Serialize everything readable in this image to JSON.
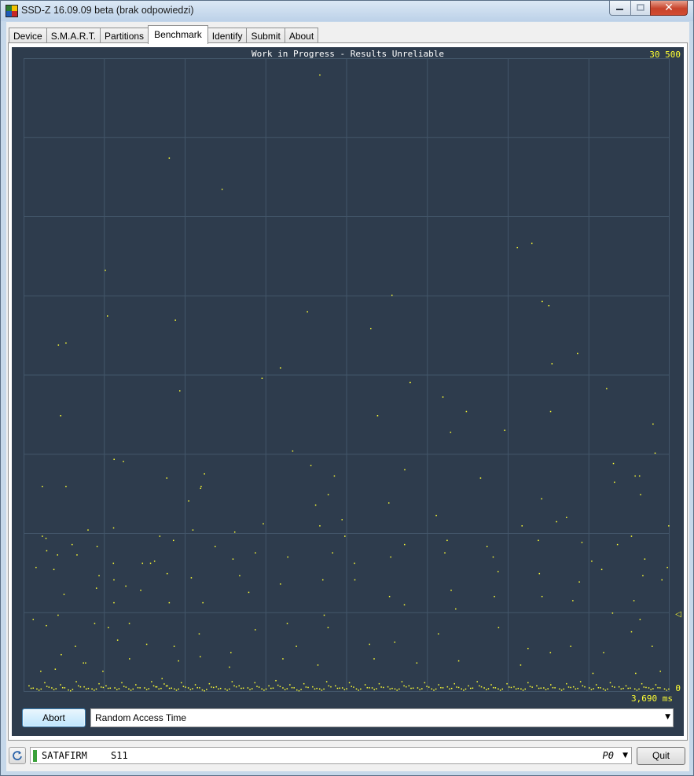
{
  "window": {
    "title": "SSD-Z 16.09.09 beta (brak odpowiedzi)",
    "close_glyph": "✕",
    "minimize_glyph": "—",
    "maximize_glyph": "□"
  },
  "tabs": [
    {
      "label": "Device",
      "active": false
    },
    {
      "label": "S.M.A.R.T.",
      "active": false
    },
    {
      "label": "Partitions",
      "active": false
    },
    {
      "label": "Benchmark",
      "active": true
    },
    {
      "label": "Identify",
      "active": false
    },
    {
      "label": "Submit",
      "active": false
    },
    {
      "label": "About",
      "active": false
    }
  ],
  "benchmark": {
    "status_title": "Work in Progress - Results Unreliable",
    "y_max_label": "30 500",
    "y_min_label": "0",
    "x_max_label": "3,690 ms",
    "marker_glyph": "◁",
    "abort_label": "Abort",
    "mode_select_value": "Random Access Time",
    "point_color": "#ffff33",
    "background_color": "#2e3c4d",
    "grid_color": "#43566a"
  },
  "status_bar": {
    "drive_model": "SATAFIRM",
    "drive_firmware": "S11",
    "port_value": "P0",
    "quit_label": "Quit"
  },
  "chart_data": {
    "type": "scatter",
    "title": "Work in Progress - Results Unreliable",
    "xlabel": "",
    "ylabel": "",
    "ylim": [
      0,
      30500
    ],
    "xlim": [
      0,
      3690
    ],
    "grid": true,
    "y_tick_labels": [
      "0",
      "30 500"
    ],
    "x_tick_labels": [
      "3,690 ms"
    ],
    "series": [
      {
        "points": [
          [
            1691,
            29700
          ],
          [
            831,
            25700
          ],
          [
            1133,
            24200
          ],
          [
            2819,
            21400
          ],
          [
            2902,
            21600
          ],
          [
            2103,
            19100
          ],
          [
            466,
            20300
          ],
          [
            1620,
            18300
          ],
          [
            2961,
            18800
          ],
          [
            2999,
            18600
          ],
          [
            478,
            18100
          ],
          [
            866,
            17900
          ],
          [
            1982,
            17500
          ],
          [
            3163,
            16300
          ],
          [
            198,
            16700
          ],
          [
            241,
            16800
          ],
          [
            3017,
            15800
          ],
          [
            2207,
            14900
          ],
          [
            1361,
            15100
          ],
          [
            211,
            13300
          ],
          [
            1466,
            15600
          ],
          [
            2528,
            13500
          ],
          [
            2394,
            14200
          ],
          [
            2438,
            12500
          ],
          [
            3009,
            13500
          ],
          [
            891,
            14500
          ],
          [
            2747,
            12600
          ],
          [
            3329,
            14600
          ],
          [
            3594,
            12900
          ],
          [
            3517,
            10400
          ],
          [
            516,
            11200
          ],
          [
            1536,
            11600
          ],
          [
            2021,
            13300
          ],
          [
            3606,
            11500
          ],
          [
            3368,
            11000
          ],
          [
            3374,
            10100
          ],
          [
            1032,
            10500
          ],
          [
            569,
            11100
          ],
          [
            1013,
            9900
          ],
          [
            1774,
            10400
          ],
          [
            1640,
            10900
          ],
          [
            1739,
            9500
          ],
          [
            2176,
            10700
          ],
          [
            2609,
            10300
          ],
          [
            2958,
            9300
          ],
          [
            3492,
            10400
          ],
          [
            3523,
            9500
          ],
          [
            106,
            9900
          ],
          [
            241,
            9900
          ],
          [
            1010,
            9800
          ],
          [
            942,
            9200
          ],
          [
            817,
            10300
          ],
          [
            1667,
            9000
          ],
          [
            1818,
            8300
          ],
          [
            2085,
            9100
          ],
          [
            2356,
            8500
          ],
          [
            2846,
            8000
          ],
          [
            3043,
            8200
          ],
          [
            3100,
            8400
          ],
          [
            3684,
            8000
          ],
          [
            106,
            7500
          ],
          [
            367,
            7800
          ],
          [
            513,
            7900
          ],
          [
            777,
            7500
          ],
          [
            966,
            7800
          ],
          [
            1205,
            7700
          ],
          [
            1368,
            8100
          ],
          [
            1691,
            8000
          ],
          [
            1834,
            7500
          ],
          [
            2175,
            7100
          ],
          [
            2418,
            7300
          ],
          [
            2646,
            7000
          ],
          [
            2939,
            7300
          ],
          [
            3188,
            7200
          ],
          [
            3471,
            7500
          ],
          [
            127,
            7400
          ],
          [
            131,
            6800
          ],
          [
            193,
            6600
          ],
          [
            276,
            7100
          ],
          [
            304,
            6600
          ],
          [
            419,
            7000
          ],
          [
            512,
            6200
          ],
          [
            678,
            6200
          ],
          [
            747,
            6300
          ],
          [
            855,
            7300
          ],
          [
            1093,
            7000
          ],
          [
            1195,
            6400
          ],
          [
            1323,
            6700
          ],
          [
            1508,
            6500
          ],
          [
            1764,
            6700
          ],
          [
            1889,
            6200
          ],
          [
            2096,
            6500
          ],
          [
            2405,
            6700
          ],
          [
            2681,
            6500
          ],
          [
            3244,
            6300
          ],
          [
            3391,
            7100
          ],
          [
            3547,
            6400
          ],
          [
            3676,
            6000
          ],
          [
            70,
            6000
          ],
          [
            172,
            5900
          ],
          [
            230,
            4700
          ],
          [
            415,
            5000
          ],
          [
            430,
            5600
          ],
          [
            515,
            5400
          ],
          [
            668,
            4900
          ],
          [
            724,
            6200
          ],
          [
            819,
            5700
          ],
          [
            957,
            5500
          ],
          [
            1233,
            5600
          ],
          [
            1466,
            5200
          ],
          [
            1708,
            5400
          ],
          [
            1891,
            5400
          ],
          [
            2089,
            4600
          ],
          [
            2441,
            4900
          ],
          [
            2709,
            5800
          ],
          [
            2945,
            5700
          ],
          [
            3173,
            5300
          ],
          [
            3301,
            5900
          ],
          [
            3536,
            5600
          ],
          [
            54,
            3500
          ],
          [
            196,
            3700
          ],
          [
            405,
            3300
          ],
          [
            515,
            4300
          ],
          [
            583,
            5100
          ],
          [
            831,
            4300
          ],
          [
            1023,
            4300
          ],
          [
            1285,
            4800
          ],
          [
            1505,
            3300
          ],
          [
            1716,
            3700
          ],
          [
            2174,
            4200
          ],
          [
            2467,
            4000
          ],
          [
            2688,
            4600
          ],
          [
            2960,
            4600
          ],
          [
            3136,
            4400
          ],
          [
            3363,
            3800
          ],
          [
            3485,
            4400
          ],
          [
            3520,
            3500
          ],
          [
            3645,
            5400
          ],
          [
            129,
            3200
          ],
          [
            295,
            2200
          ],
          [
            341,
            1400
          ],
          [
            483,
            3100
          ],
          [
            536,
            2500
          ],
          [
            603,
            3300
          ],
          [
            702,
            2300
          ],
          [
            859,
            2200
          ],
          [
            1002,
            2800
          ],
          [
            1183,
            1900
          ],
          [
            1322,
            3000
          ],
          [
            1557,
            2200
          ],
          [
            1738,
            3100
          ],
          [
            1975,
            2300
          ],
          [
            2119,
            2400
          ],
          [
            2368,
            2800
          ],
          [
            2712,
            3100
          ],
          [
            2880,
            2100
          ],
          [
            3124,
            2200
          ],
          [
            3312,
            1900
          ],
          [
            3471,
            2900
          ],
          [
            3589,
            2200
          ],
          [
            97,
            1000
          ],
          [
            180,
            1100
          ],
          [
            214,
            1800
          ],
          [
            353,
            1400
          ],
          [
            452,
            1000
          ],
          [
            604,
            1600
          ],
          [
            884,
            1500
          ],
          [
            1008,
            1700
          ],
          [
            1175,
            1200
          ],
          [
            1480,
            1600
          ],
          [
            1680,
            1300
          ],
          [
            2001,
            1600
          ],
          [
            2245,
            1400
          ],
          [
            2484,
            1500
          ],
          [
            2838,
            1300
          ],
          [
            3008,
            1900
          ],
          [
            3251,
            900
          ],
          [
            3495,
            900
          ],
          [
            3636,
            1000
          ]
        ],
        "dense_band_near_zero": [
          [
            30,
            300
          ],
          [
            75,
            150
          ],
          [
            120,
            450
          ],
          [
            160,
            200
          ],
          [
            210,
            350
          ],
          [
            255,
            100
          ],
          [
            300,
            500
          ],
          [
            345,
            250
          ],
          [
            390,
            150
          ],
          [
            430,
            400
          ],
          [
            470,
            300
          ],
          [
            520,
            200
          ],
          [
            560,
            450
          ],
          [
            600,
            150
          ],
          [
            640,
            350
          ],
          [
            690,
            200
          ],
          [
            730,
            500
          ],
          [
            760,
            250
          ],
          [
            790,
            650
          ],
          [
            820,
            300
          ],
          [
            860,
            150
          ],
          [
            900,
            450
          ],
          [
            940,
            200
          ],
          [
            980,
            350
          ],
          [
            1020,
            100
          ],
          [
            1060,
            400
          ],
          [
            1100,
            250
          ],
          [
            1150,
            150
          ],
          [
            1190,
            500
          ],
          [
            1230,
            300
          ],
          [
            1280,
            200
          ],
          [
            1320,
            450
          ],
          [
            1360,
            150
          ],
          [
            1400,
            300
          ],
          [
            1440,
            550
          ],
          [
            1480,
            200
          ],
          [
            1520,
            350
          ],
          [
            1560,
            100
          ],
          [
            1600,
            400
          ],
          [
            1650,
            250
          ],
          [
            1690,
            150
          ],
          [
            1730,
            500
          ],
          [
            1780,
            300
          ],
          [
            1820,
            200
          ],
          [
            1860,
            450
          ],
          [
            1900,
            150
          ],
          [
            1950,
            350
          ],
          [
            1990,
            200
          ],
          [
            2030,
            400
          ],
          [
            2080,
            250
          ],
          [
            2120,
            150
          ],
          [
            2160,
            500
          ],
          [
            2200,
            300
          ],
          [
            2250,
            200
          ],
          [
            2290,
            450
          ],
          [
            2330,
            150
          ],
          [
            2370,
            350
          ],
          [
            2420,
            250
          ],
          [
            2460,
            400
          ],
          [
            2500,
            150
          ],
          [
            2540,
            300
          ],
          [
            2590,
            500
          ],
          [
            2630,
            200
          ],
          [
            2670,
            350
          ],
          [
            2710,
            150
          ],
          [
            2760,
            400
          ],
          [
            2800,
            250
          ],
          [
            2840,
            150
          ],
          [
            2880,
            450
          ],
          [
            2930,
            300
          ],
          [
            2970,
            200
          ],
          [
            3010,
            350
          ],
          [
            3060,
            150
          ],
          [
            3100,
            400
          ],
          [
            3140,
            250
          ],
          [
            3180,
            500
          ],
          [
            3230,
            200
          ],
          [
            3270,
            350
          ],
          [
            3310,
            150
          ],
          [
            3350,
            450
          ],
          [
            3400,
            250
          ],
          [
            3440,
            300
          ],
          [
            3490,
            150
          ],
          [
            3530,
            400
          ],
          [
            3570,
            200
          ],
          [
            3610,
            350
          ],
          [
            3660,
            150
          ]
        ]
      }
    ]
  }
}
